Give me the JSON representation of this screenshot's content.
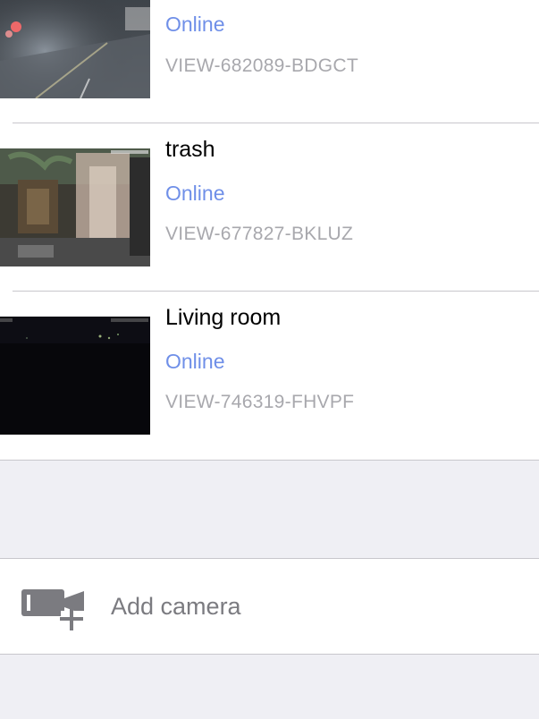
{
  "colors": {
    "online": "#6f8fe8",
    "secondary_text": "#a8a8ad",
    "grouped_background": "#efeff4",
    "separator": "#c8c7cc"
  },
  "cameras": [
    {
      "name": "",
      "status": "Online",
      "id": "VIEW-682089-BDGCT",
      "thumbnail": "street-night-camera-feed"
    },
    {
      "name": "trash",
      "status": "Online",
      "id": "VIEW-677827-BKLUZ",
      "thumbnail": "outdoor-patio-camera-feed"
    },
    {
      "name": "Living room",
      "status": "Online",
      "id": "VIEW-746319-FHVPF",
      "thumbnail": "dark-room-camera-feed"
    }
  ],
  "add_camera": {
    "label": "Add camera",
    "icon": "add-video-camera-icon"
  }
}
